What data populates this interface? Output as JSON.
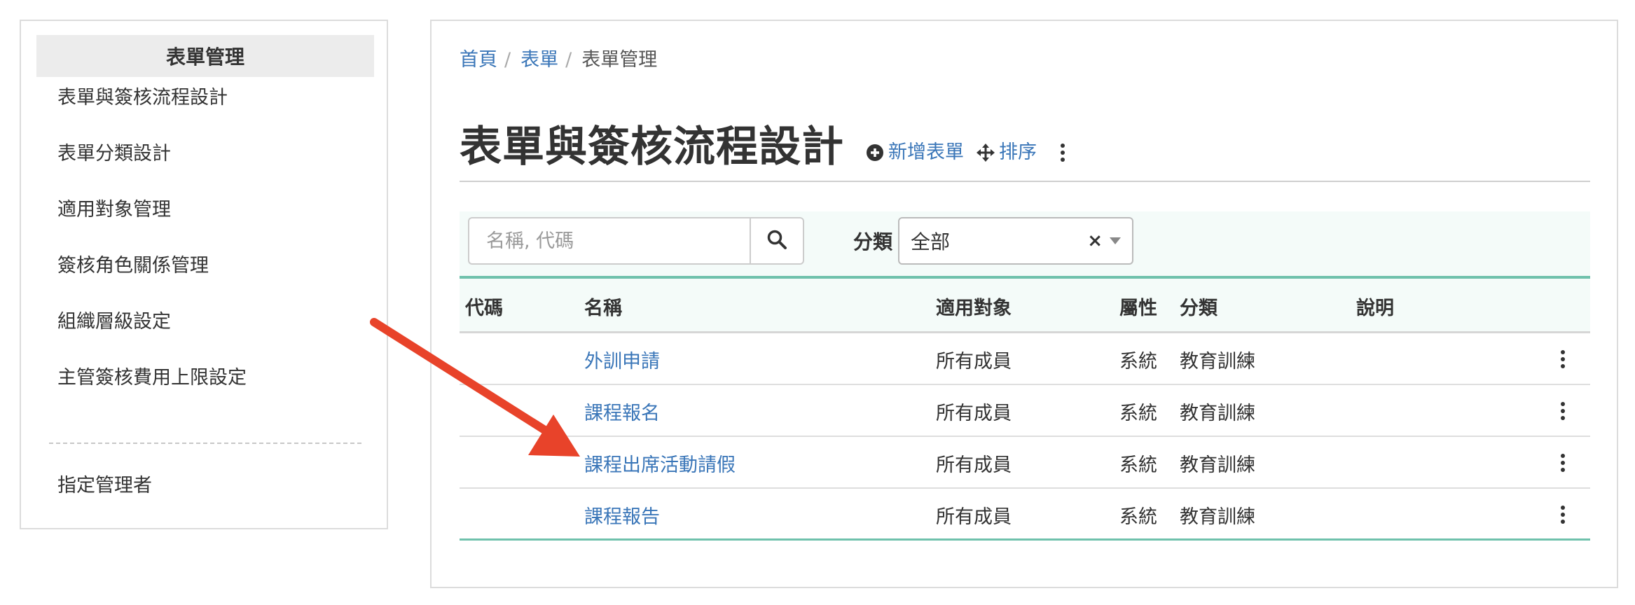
{
  "sidebar": {
    "header": "表單管理",
    "items": [
      {
        "label": "表單與簽核流程設計"
      },
      {
        "label": "表單分類設計"
      },
      {
        "label": "適用對象管理"
      },
      {
        "label": "簽核角色關係管理"
      },
      {
        "label": "組織層級設定"
      },
      {
        "label": "主管簽核費用上限設定"
      }
    ],
    "footer_item": {
      "label": "指定管理者"
    }
  },
  "breadcrumb": {
    "items": [
      {
        "label": "首頁"
      },
      {
        "label": "表單"
      }
    ],
    "separator": "/",
    "current": "表單管理"
  },
  "page": {
    "title": "表單與簽核流程設計",
    "actions": {
      "add_label": "新增表單",
      "sort_label": "排序"
    }
  },
  "filter": {
    "search_placeholder": "名稱, 代碼",
    "search_value": "",
    "category_label": "分類",
    "category_value": "全部",
    "clear_symbol": "×"
  },
  "table": {
    "columns": [
      "代碼",
      "名稱",
      "適用對象",
      "屬性",
      "分類",
      "說明"
    ],
    "rows": [
      {
        "code": "",
        "name": "外訓申請",
        "target": "所有成員",
        "attr": "系統",
        "category": "教育訓練",
        "desc": ""
      },
      {
        "code": "",
        "name": "課程報名",
        "target": "所有成員",
        "attr": "系統",
        "category": "教育訓練",
        "desc": ""
      },
      {
        "code": "",
        "name": "課程出席活動請假",
        "target": "所有成員",
        "attr": "系統",
        "category": "教育訓練",
        "desc": ""
      },
      {
        "code": "",
        "name": "課程報告",
        "target": "所有成員",
        "attr": "系統",
        "category": "教育訓練",
        "desc": ""
      }
    ]
  },
  "colors": {
    "link": "#3a76b8",
    "accent_teal": "#6fc1ac",
    "annotation_arrow": "#e8432a"
  },
  "icons": {
    "add": "plus-circle-icon",
    "sort": "move-arrows-icon",
    "more": "vertical-ellipsis-icon",
    "search": "magnifier-icon",
    "annotation": "red-arrow"
  }
}
